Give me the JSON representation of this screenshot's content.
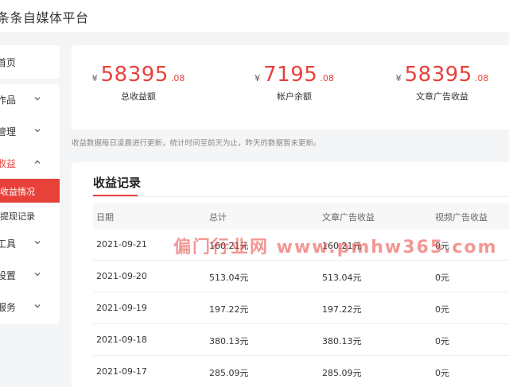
{
  "app": {
    "title": "条条自媒体平台"
  },
  "sidebar": {
    "top_item": "首页",
    "items": [
      {
        "label": "作品",
        "open": false
      },
      {
        "label": "管理",
        "open": false
      },
      {
        "label": "收益",
        "open": true
      },
      {
        "label": "工具",
        "open": false
      },
      {
        "label": "设置",
        "open": false
      },
      {
        "label": "服务",
        "open": false
      }
    ],
    "sub_items": [
      "收益情况",
      "提现记录"
    ],
    "active_sub": "收益情况"
  },
  "stats": [
    {
      "currency": "¥",
      "integer": "58395",
      "decimal": ".08",
      "label": "总收益额"
    },
    {
      "currency": "¥",
      "integer": "7195",
      "decimal": ".08",
      "label": "帐户余额"
    },
    {
      "currency": "¥",
      "integer": "58395",
      "decimal": ".08",
      "label": "文章广告收益"
    }
  ],
  "note": "收益数据每日凌晨进行更新，统计时间至前天为止，昨天的数据暂未更新。",
  "records": {
    "title": "收益记录",
    "columns": [
      "日期",
      "总计",
      "文章广告收益",
      "视频广告收益"
    ],
    "rows": [
      [
        "2021-09-21",
        "160.21元",
        "160.21元",
        "0元"
      ],
      [
        "2021-09-20",
        "513.04元",
        "513.04元",
        "0元"
      ],
      [
        "2021-09-19",
        "197.22元",
        "197.22元",
        "0元"
      ],
      [
        "2021-09-18",
        "380.13元",
        "380.13元",
        "0元"
      ],
      [
        "2021-09-17",
        "285.09元",
        "285.09元",
        "0元"
      ]
    ]
  },
  "watermark": "偏门行业网 www.pmhw365.com",
  "colors": {
    "accent": "#e7413a",
    "background": "#f4f5f6"
  }
}
